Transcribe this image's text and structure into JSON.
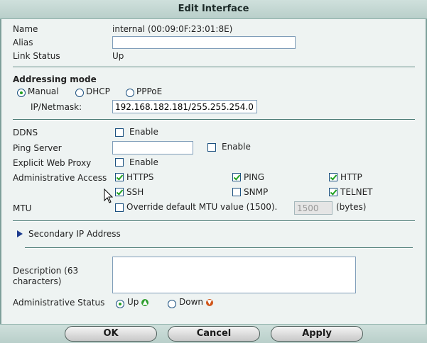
{
  "dialog": {
    "title": "Edit Interface"
  },
  "fields": {
    "name_label": "Name",
    "name_value": "internal (00:09:0F:23:01:8E)",
    "alias_label": "Alias",
    "alias_value": "",
    "link_status_label": "Link Status",
    "link_status_value": "Up"
  },
  "addressing": {
    "heading": "Addressing mode",
    "options": [
      "Manual",
      "DHCP",
      "PPPoE"
    ],
    "selected": "Manual",
    "ip_label": "IP/Netmask:",
    "ip_value": "192.168.182.181/255.255.254.0"
  },
  "ddns": {
    "label": "DDNS",
    "enable": "Enable",
    "checked": false
  },
  "ping_server": {
    "label": "Ping Server",
    "value": "",
    "enable": "Enable",
    "checked": false
  },
  "web_proxy": {
    "label": "Explicit Web Proxy",
    "enable": "Enable",
    "checked": false
  },
  "admin_access": {
    "label": "Administrative Access",
    "options": [
      {
        "name": "HTTPS",
        "checked": true
      },
      {
        "name": "PING",
        "checked": true
      },
      {
        "name": "HTTP",
        "checked": true
      },
      {
        "name": "SSH",
        "checked": true
      },
      {
        "name": "SNMP",
        "checked": false
      },
      {
        "name": "TELNET",
        "checked": true
      }
    ]
  },
  "mtu": {
    "label": "MTU",
    "override_label": "Override default MTU value (1500).",
    "value": "1500",
    "unit": "(bytes)",
    "checked": false
  },
  "secondary_ip": {
    "label": "Secondary IP Address"
  },
  "description": {
    "label": "Description (63 characters)",
    "value": ""
  },
  "admin_status": {
    "label": "Administrative Status",
    "up": "Up",
    "down": "Down",
    "selected": "Up"
  },
  "buttons": {
    "ok": "OK",
    "cancel": "Cancel",
    "apply": "Apply"
  },
  "colors": {
    "accent": "#21a121",
    "title_bg": "#c3d8d3",
    "body_bg": "#eef3f2"
  },
  "icons": {
    "secondary_toggle": "triangle-right-icon",
    "up": "arrow-up-icon",
    "down": "arrow-down-icon"
  }
}
